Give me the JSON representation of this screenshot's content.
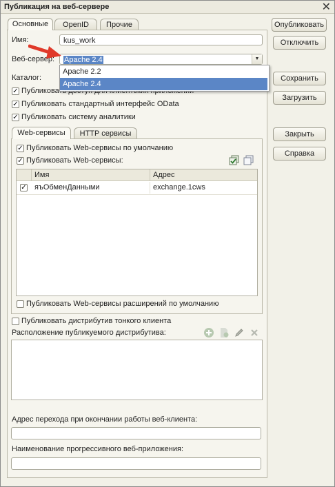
{
  "window": {
    "title": "Публикация на веб-сервере"
  },
  "tabs": [
    {
      "label": "Основные",
      "active": true
    },
    {
      "label": "OpenID",
      "active": false
    },
    {
      "label": "Прочие",
      "active": false
    }
  ],
  "form": {
    "name_label": "Имя:",
    "name_value": "kus_work",
    "webserver_label": "Веб-сервер:",
    "webserver_value": "Apache 2.4",
    "catalog_label": "Каталог:",
    "webserver_options": [
      {
        "label": "Apache 2.2",
        "selected": false
      },
      {
        "label": "Apache 2.4",
        "selected": true
      }
    ]
  },
  "checkboxes": {
    "publish_thick_client": {
      "label": "Публиковать доступ для клиентских приложений",
      "checked": true
    },
    "publish_odata": {
      "label": "Публиковать стандартный интерфейс OData",
      "checked": true
    },
    "publish_analytics": {
      "label": "Публиковать систему аналитики",
      "checked": true
    }
  },
  "service_tabs": [
    {
      "label": "Web-сервисы",
      "active": true
    },
    {
      "label": "HTTP сервисы",
      "active": false
    }
  ],
  "web_services": {
    "publish_default": {
      "label": "Публиковать Web-сервисы по умолчанию",
      "checked": true
    },
    "publish_list": {
      "label": "Публиковать Web-сервисы:",
      "checked": true
    },
    "columns": {
      "name": "Имя",
      "address": "Адрес"
    },
    "rows": [
      {
        "checked": true,
        "name": "яъОбменДанными",
        "address": "exchange.1cws"
      }
    ],
    "publish_extensions": {
      "label": "Публиковать Web-сервисы расширений по умолчанию",
      "checked": false
    }
  },
  "thin_client": {
    "publish_distr": {
      "label": "Публиковать дистрибутив тонкого клиента",
      "checked": false
    },
    "location_label": "Расположение публикуемого дистрибутива:"
  },
  "bottom": {
    "redirect_label": "Адрес перехода при окончании работы веб-клиента:",
    "redirect_value": "",
    "pwa_label": "Наименование прогрессивного веб-приложения:",
    "pwa_value": ""
  },
  "buttons": {
    "publish": "Опубликовать",
    "disable": "Отключить",
    "save": "Сохранить",
    "load": "Загрузить",
    "close": "Закрыть",
    "help": "Справка"
  },
  "colors": {
    "selection": "#5b86c6",
    "arrow": "#e03a2a"
  }
}
